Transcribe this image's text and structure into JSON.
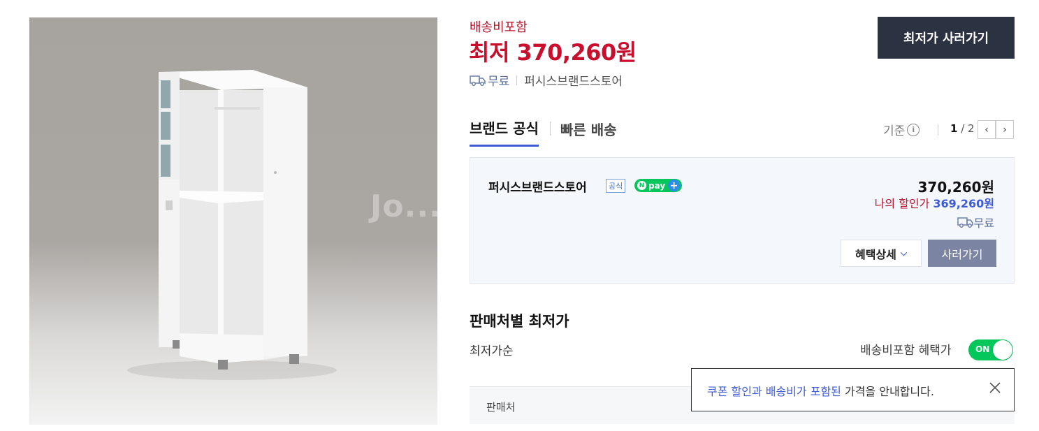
{
  "product": {
    "watermark": "Jo...",
    "image_alt": "white storage cabinet with drawers and hanging rail"
  },
  "price": {
    "shipping_included": "배송비포함",
    "lowest_prefix": "최저",
    "lowest_value": "370,260원",
    "shipping_free": "무료",
    "store": "퍼시스브랜드스토어"
  },
  "buy_lowest_button": "최저가 사러가기",
  "tabs": [
    {
      "label": "브랜드 공식",
      "active": true
    },
    {
      "label": "빠른 배송",
      "active": false
    }
  ],
  "criteria_label": "기준",
  "pager": {
    "current": "1",
    "total": "/ 2"
  },
  "store_card": {
    "name": "퍼시스브랜드스토어",
    "official": "공식",
    "npay": "pay",
    "price": "370,260원",
    "my_discount_label": "나의 할인가",
    "my_discount_value": "369,260원",
    "shipping": "무료",
    "benefit_button": "혜택상세",
    "buy_button": "사러가기"
  },
  "seller_section": {
    "title": "판매처별 최저가",
    "sort": "최저가순",
    "include_label": "배송비포함 혜택가",
    "toggle_label": "ON",
    "header_col": "판매처"
  },
  "tooltip": {
    "highlight": "쿠폰 할인과 배송비가 포함된",
    "rest": " 가격을 안내합니다."
  },
  "colors": {
    "price_red": "#c8102e",
    "accent_blue": "#3f5bd3",
    "dark_button": "#2b3242",
    "toggle_green": "#03c75a"
  }
}
